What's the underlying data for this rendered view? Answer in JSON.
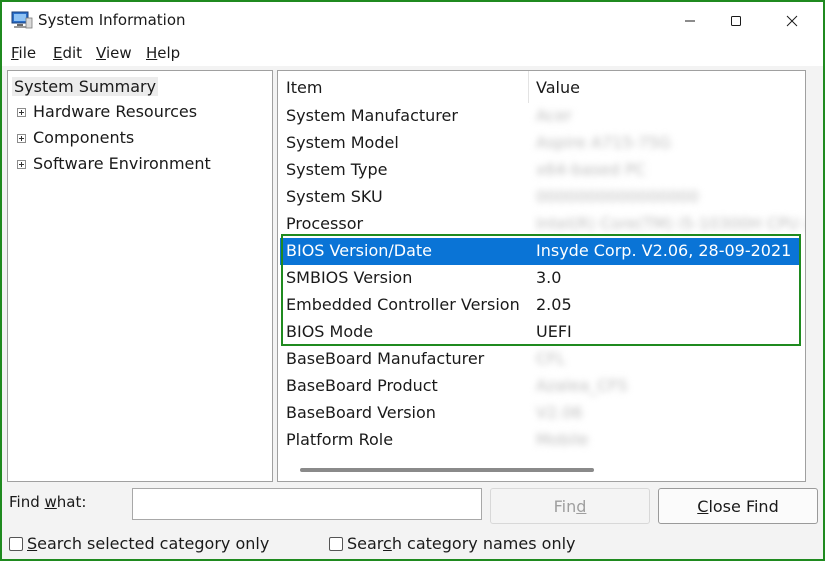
{
  "window": {
    "title": "System Information"
  },
  "menu": {
    "file": "File",
    "edit": "Edit",
    "view": "View",
    "help": "Help"
  },
  "tree": {
    "root": "System Summary",
    "children": [
      "Hardware Resources",
      "Components",
      "Software Environment"
    ]
  },
  "table": {
    "columns": [
      "Item",
      "Value"
    ],
    "rows": [
      {
        "item": "System Manufacturer",
        "value": "Acer"
      },
      {
        "item": "System Model",
        "value": "Aspire A715-75G"
      },
      {
        "item": "System Type",
        "value": "x64-based PC"
      },
      {
        "item": "System SKU",
        "value": "0000000000000000"
      },
      {
        "item": "Processor",
        "value": "Intel(R) Core(TM) i5-10300H CPU @"
      },
      {
        "item": "BIOS Version/Date",
        "value": "Insyde Corp. V2.06, 28-09-2021"
      },
      {
        "item": "SMBIOS Version",
        "value": "3.0"
      },
      {
        "item": "Embedded Controller Version",
        "value": "2.05"
      },
      {
        "item": "BIOS Mode",
        "value": "UEFI"
      },
      {
        "item": "BaseBoard Manufacturer",
        "value": "CFL"
      },
      {
        "item": "BaseBoard Product",
        "value": "Azalea_CFS"
      },
      {
        "item": "BaseBoard Version",
        "value": "V2.06"
      },
      {
        "item": "Platform Role",
        "value": "Mobile"
      }
    ]
  },
  "find": {
    "label": "Find what:",
    "value": "",
    "find_button": "Find",
    "close_find_button": "Close Find",
    "search_selected": "Search selected category only",
    "search_names": "Search category names only"
  },
  "colors": {
    "selection": "#0a74d6",
    "highlight_border": "#1f8a1f"
  }
}
